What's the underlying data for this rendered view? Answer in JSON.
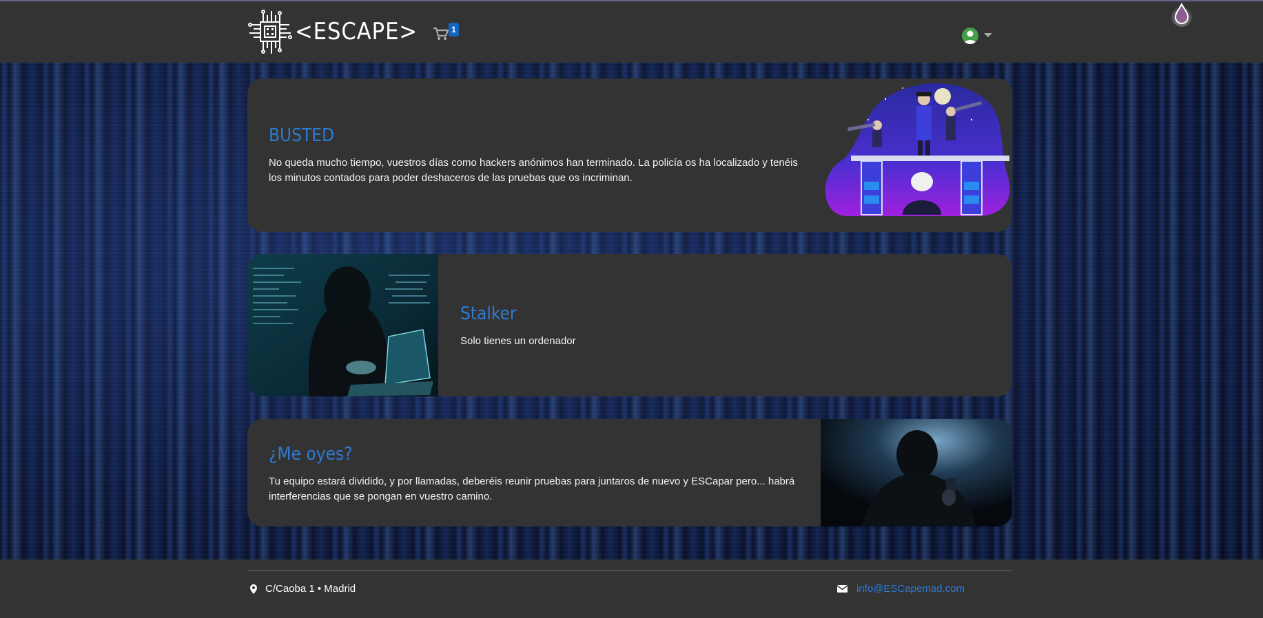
{
  "header": {
    "logo_text": "<ESCAPE>",
    "cart_count": "1",
    "icons": {
      "cart": "cart-icon",
      "user": "user-avatar-icon",
      "menu": "chevron-down-icon",
      "extension": "drop-icon"
    }
  },
  "rooms": [
    {
      "title": "BUSTED",
      "description": "No queda mucho tiempo, vuestros días como hackers anónimos han terminado. La policía os ha localizado y tenéis los minutos contados para poder deshaceros de las pruebas que os incriminan."
    },
    {
      "title": "Stalker",
      "description": "Solo tienes un ordenador"
    },
    {
      "title": "¿Me oyes?",
      "description": "Tu equipo estará dividido, y por llamadas, deberéis reunir pruebas para juntaros de nuevo y ESCapar pero... habrá interferencias que se pongan en vuestro camino."
    }
  ],
  "footer": {
    "address": "C/Caoba 1 • Madrid",
    "email": "info@ESCapemad.com"
  },
  "colors": {
    "accent": "#2d7bd6",
    "panel": "#333333",
    "badge": "#1565c0"
  }
}
